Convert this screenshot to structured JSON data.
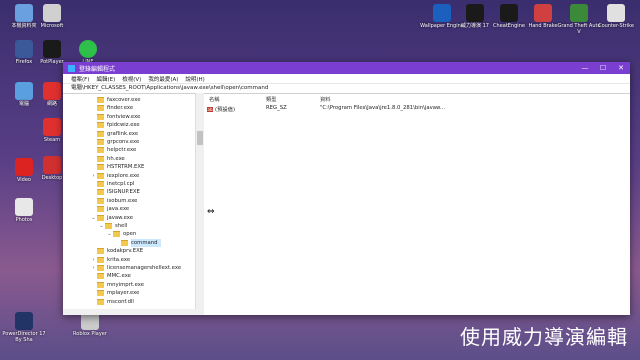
{
  "window": {
    "title": "登錄編輯程式",
    "minimize": "—",
    "maximize": "☐",
    "close": "✕",
    "menu": [
      "檔案(F)",
      "編輯(E)",
      "檢視(V)",
      "我的最愛(A)",
      "說明(H)"
    ],
    "address": "電腦\\HKEY_CLASSES_ROOT\\Applications\\javaw.exe\\shell\\open\\command"
  },
  "tree": {
    "items": [
      {
        "label": "faxcover.exe",
        "exp": "",
        "indent": 0
      },
      {
        "label": "finder.exe",
        "exp": "",
        "indent": 0
      },
      {
        "label": "fontview.exe",
        "exp": "",
        "indent": 0
      },
      {
        "label": "fpidcwiz.exe",
        "exp": "",
        "indent": 0
      },
      {
        "label": "graflink.exe",
        "exp": "",
        "indent": 0
      },
      {
        "label": "grpconv.exe",
        "exp": "",
        "indent": 0
      },
      {
        "label": "helpctr.exe",
        "exp": "",
        "indent": 0
      },
      {
        "label": "hh.exe",
        "exp": "",
        "indent": 0
      },
      {
        "label": "HSTRTRM.EXE",
        "exp": "",
        "indent": 0
      },
      {
        "label": "iexplore.exe",
        "exp": ">",
        "indent": 0
      },
      {
        "label": "inetcpl.cpl",
        "exp": "",
        "indent": 0
      },
      {
        "label": "ISIGNUP.EXE",
        "exp": "",
        "indent": 0
      },
      {
        "label": "isobum.exe",
        "exp": "",
        "indent": 0
      },
      {
        "label": "java.exe",
        "exp": "",
        "indent": 0
      },
      {
        "label": "javaw.exe",
        "exp": "v",
        "indent": 0
      },
      {
        "label": "shell",
        "exp": "v",
        "indent": 1
      },
      {
        "label": "open",
        "exp": "v",
        "indent": 2
      },
      {
        "label": "command",
        "exp": "",
        "indent": 3,
        "selected": true
      },
      {
        "label": "kodakprv.EXE",
        "exp": "",
        "indent": 0
      },
      {
        "label": "krita.exe",
        "exp": ">",
        "indent": 0
      },
      {
        "label": "licensemanagershellext.exe",
        "exp": ">",
        "indent": 0
      },
      {
        "label": "MMC.exe",
        "exp": "",
        "indent": 0
      },
      {
        "label": "mnyimprt.exe",
        "exp": "",
        "indent": 0
      },
      {
        "label": "mplayer.exe",
        "exp": "",
        "indent": 0
      },
      {
        "label": "msconf.dll",
        "exp": "",
        "indent": 0
      }
    ]
  },
  "values_pane": {
    "headers": {
      "name": "名稱",
      "type": "類型",
      "data": "資料"
    },
    "rows": [
      {
        "name": "(預設值)",
        "type": "REG_SZ",
        "data": "\"C:\\Program Files\\Java\\jre1.8.0_281\\bin\\javaw..."
      }
    ]
  },
  "desktop_icons": [
    {
      "label": "本機資料夾",
      "color": "#6aa0e0"
    },
    {
      "label": "Microsoft",
      "color": "#d0d0d0"
    },
    {
      "label": "PotPlayer",
      "color": "#1a1a1a"
    },
    {
      "label": "LINE",
      "color": "#2ec04a"
    },
    {
      "label": "Firefox",
      "color": "#3b5998"
    },
    {
      "label": "電腦",
      "color": "#5aa0e0"
    },
    {
      "label": "網路",
      "color": "#e03030"
    },
    {
      "label": "Video",
      "color": "#d22"
    },
    {
      "label": "Photos",
      "color": "#e8e8e8"
    },
    {
      "label": "Steam",
      "color": "#e03030"
    },
    {
      "label": "Desktop",
      "color": "#d03030"
    },
    {
      "label": "PowerDirector 17 By Sha",
      "color": "#223366"
    },
    {
      "label": "Roblox Player",
      "color": "#cccccc"
    }
  ],
  "top_icons": [
    {
      "label": "Wallpaper Engine",
      "color": "#1b5fbf"
    },
    {
      "label": "威力導演 17",
      "color": "#1a1a1a"
    },
    {
      "label": "CheatEngine",
      "color": "#1a1a1a"
    },
    {
      "label": "Hand Brake",
      "color": "#d04040"
    },
    {
      "label": "Grand Theft Auto V",
      "color": "#3a8a3a"
    },
    {
      "label": "Counter-Strike",
      "color": "#e0e0e0"
    }
  ],
  "overlay_caption": "使用威力導演編輯"
}
